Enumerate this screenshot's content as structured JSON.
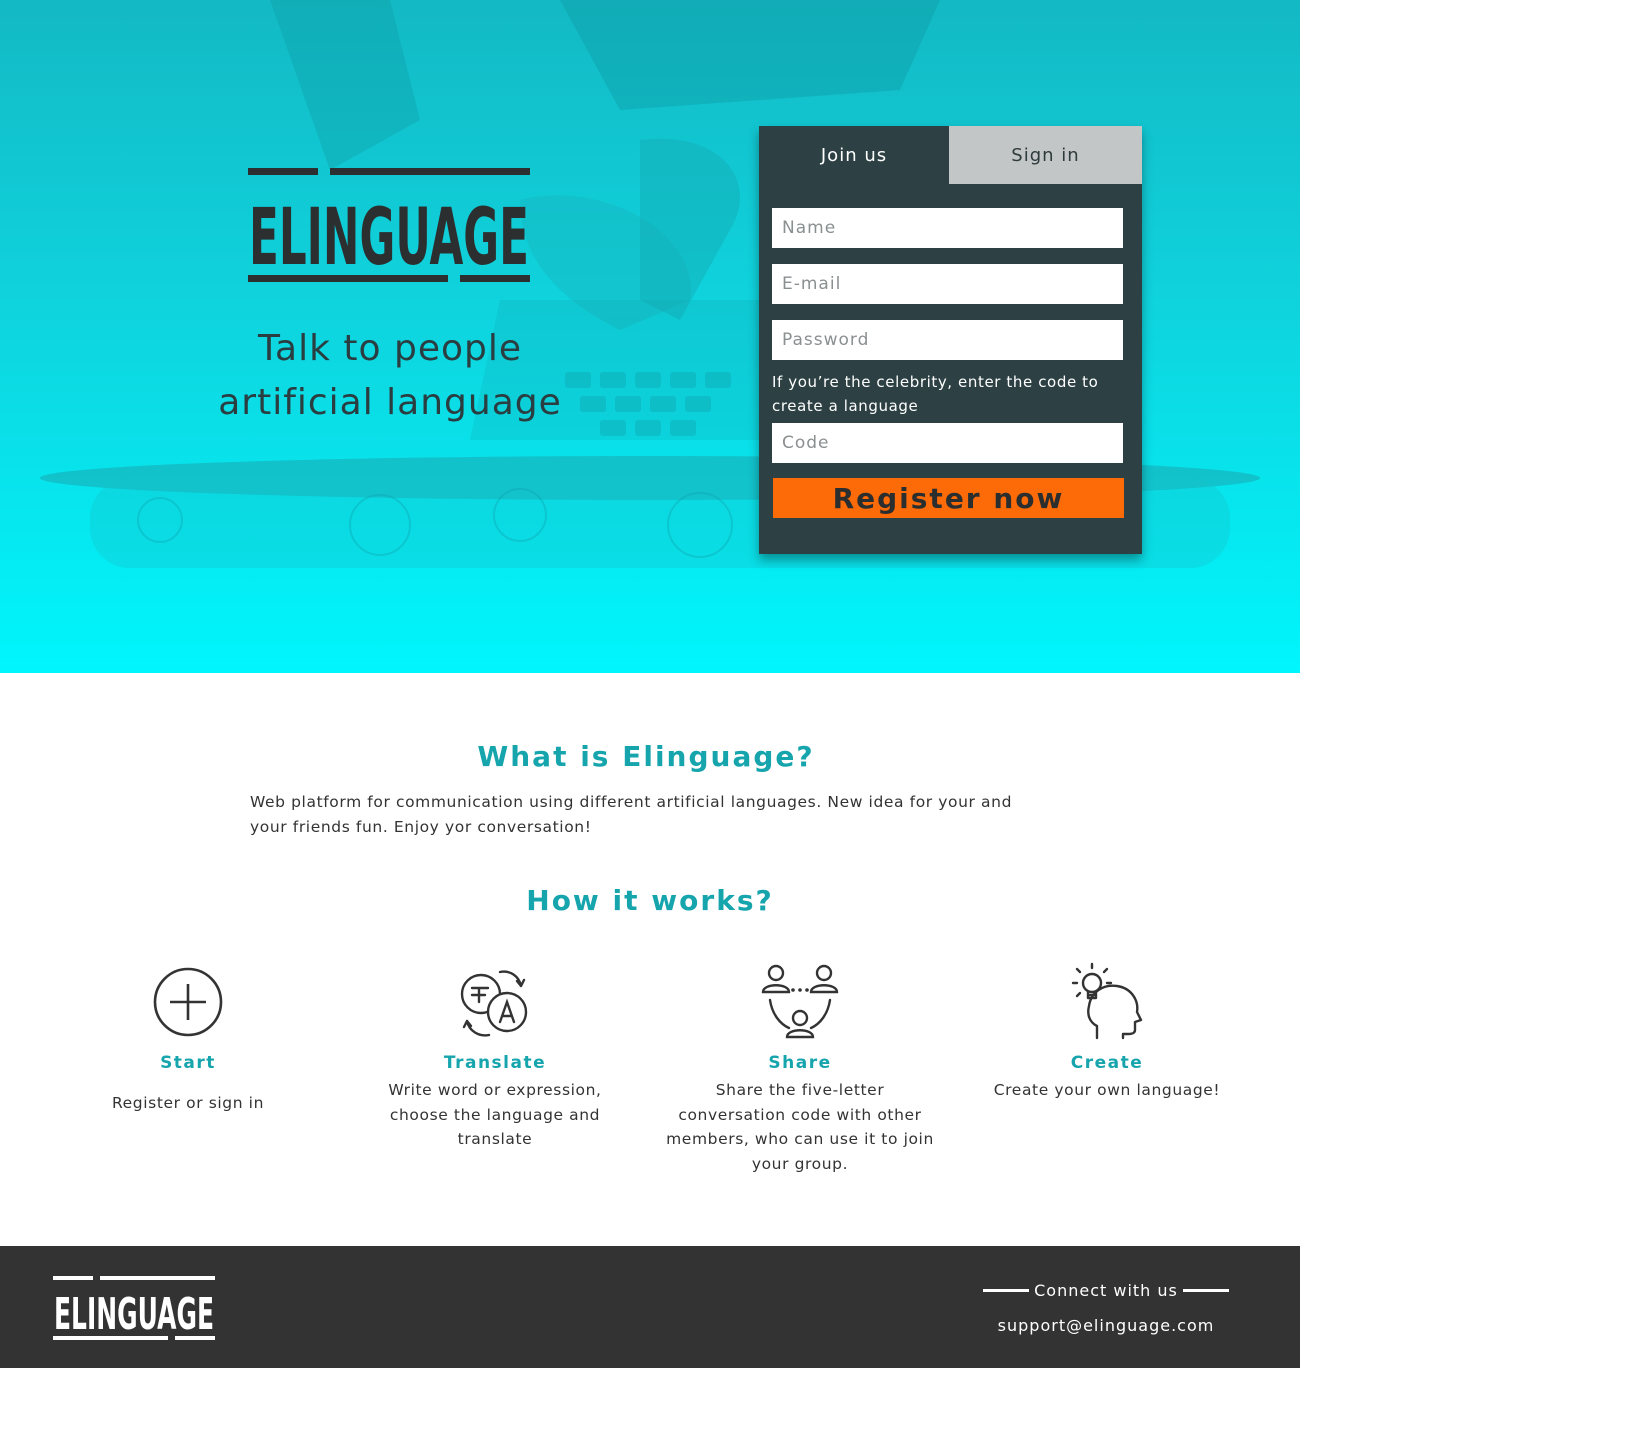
{
  "hero": {
    "logo_text": "ELINGUAGE",
    "tagline_line1": "Talk to people",
    "tagline_line2": "artificial language"
  },
  "form": {
    "tabs": [
      {
        "label": "Join us",
        "active": true
      },
      {
        "label": "Sign in",
        "active": false
      }
    ],
    "name_placeholder": "Name",
    "email_placeholder": "E-mail",
    "password_placeholder": "Password",
    "celebrity_note": "If you’re the celebrity, enter the code to create a language",
    "code_placeholder": "Code",
    "register_label": "Register now"
  },
  "about": {
    "title": "What is Elinguage?",
    "text": "Web platform for communication using different artificial languages. New idea for your and your friends fun. Enjoy yor conversation!"
  },
  "how": {
    "title": "How it works?",
    "steps": [
      {
        "icon": "plus-circle-icon",
        "title": "Start",
        "desc": "Register or sign in"
      },
      {
        "icon": "translate-icon",
        "title": "Translate",
        "desc": "Write word or expression, choose the language and translate"
      },
      {
        "icon": "share-group-icon",
        "title": "Share",
        "desc": "Share the five-letter conversation code with other members, who can use it to join your group."
      },
      {
        "icon": "idea-head-icon",
        "title": "Create",
        "desc": "Create your own language!"
      }
    ]
  },
  "footer": {
    "logo_text": "ELINGUAGE",
    "connect_label": "Connect with us",
    "support_email": "support@elinguage.com"
  },
  "colors": {
    "accent_teal": "#16a4ad",
    "cyan_bg": "#00f6fd",
    "panel_bg": "#2d4144",
    "register_orange": "#fc6b07",
    "footer_bg": "#333333"
  }
}
